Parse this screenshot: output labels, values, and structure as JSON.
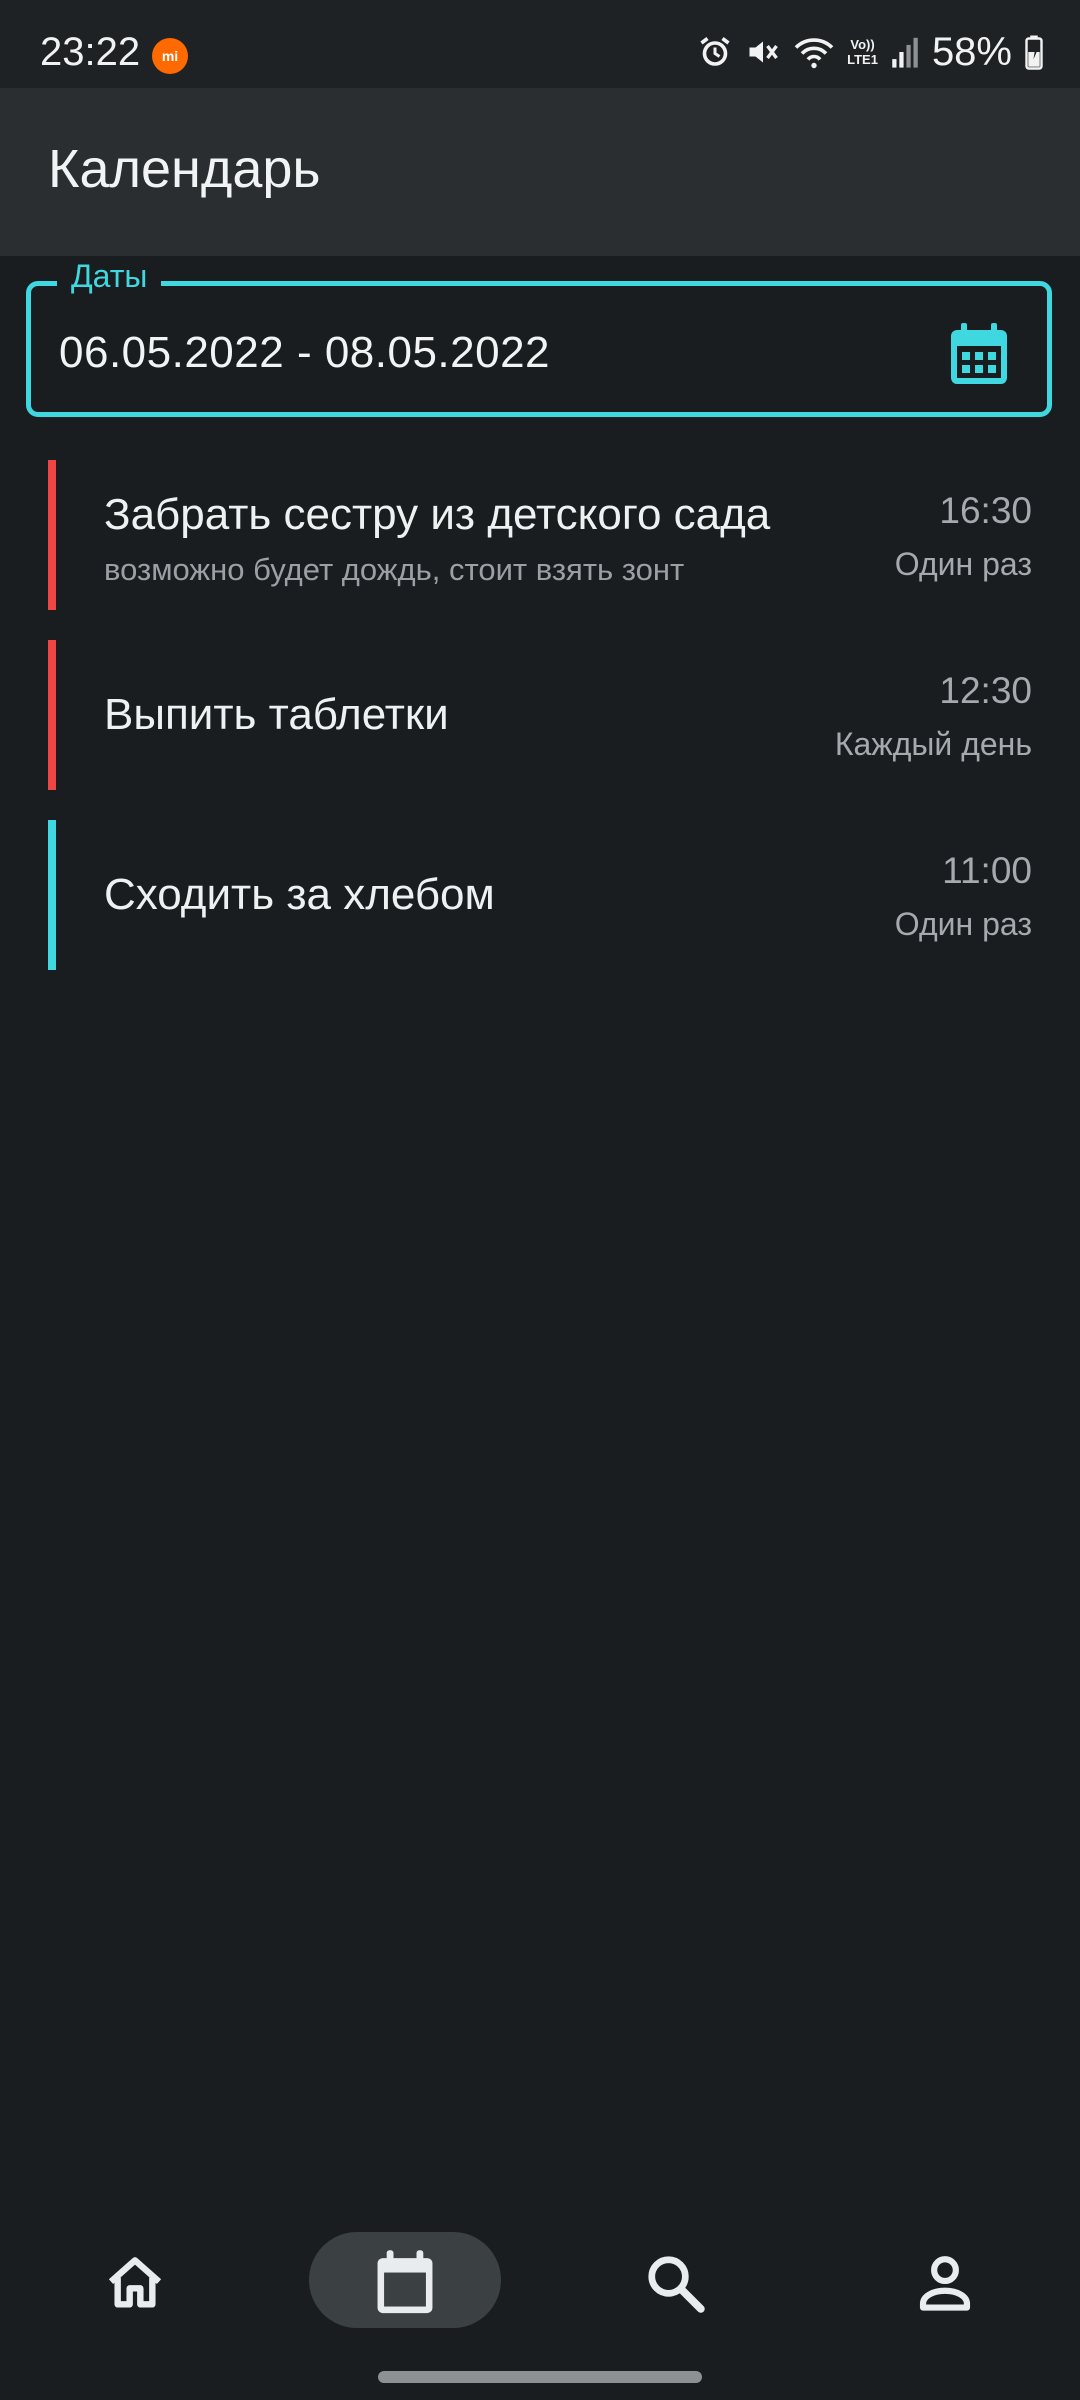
{
  "status_bar": {
    "time": "23:22",
    "battery": "58%",
    "network_label_top": "Vo))",
    "network_label_bottom": "LTE1",
    "icons": [
      "mi-notification-icon",
      "alarm-icon",
      "vibrate-off-icon",
      "wifi-icon",
      "signal-icon",
      "battery-icon"
    ]
  },
  "app_bar": {
    "title": "Календарь"
  },
  "dates_field": {
    "label": "Даты",
    "value": "06.05.2022 - 08.05.2022",
    "icon": "calendar-icon",
    "accent_color": "#3fd7e0"
  },
  "events": [
    {
      "title": "Забрать сестру из детского сада",
      "description": "возможно будет дождь, стоит взять зонт",
      "time": "16:30",
      "repeat": "Один раз",
      "color": "#ee4545"
    },
    {
      "title": "Выпить таблетки",
      "description": "",
      "time": "12:30",
      "repeat": "Каждый день",
      "color": "#ee4545"
    },
    {
      "title": "Сходить за хлебом",
      "description": "",
      "time": "11:00",
      "repeat": "Один раз",
      "color": "#3fd7e0"
    }
  ],
  "bottom_nav": {
    "items": [
      "home-icon",
      "calendar-icon",
      "search-icon",
      "profile-icon"
    ],
    "active": "calendar-icon"
  }
}
